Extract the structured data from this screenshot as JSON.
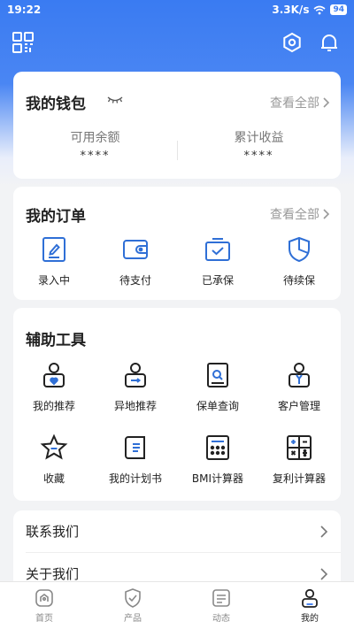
{
  "status_bar": {
    "time": "19:22",
    "network_speed": "3.3K/s",
    "battery": "94"
  },
  "wallet": {
    "title": "我的钱包",
    "view_all": "查看全部",
    "balance_label": "可用余额",
    "balance_value": "****",
    "earnings_label": "累计收益",
    "earnings_value": "****"
  },
  "orders": {
    "title": "我的订单",
    "view_all": "查看全部",
    "items": [
      {
        "label": "录入中",
        "icon": "edit-document-icon"
      },
      {
        "label": "待支付",
        "icon": "wallet-icon"
      },
      {
        "label": "已承保",
        "icon": "inbox-check-icon"
      },
      {
        "label": "待续保",
        "icon": "shield-icon"
      }
    ]
  },
  "tools": {
    "title": "辅助工具",
    "items": [
      {
        "label": "我的推荐",
        "icon": "user-heart-icon"
      },
      {
        "label": "异地推荐",
        "icon": "user-arrow-icon"
      },
      {
        "label": "保单查询",
        "icon": "document-search-icon"
      },
      {
        "label": "客户管理",
        "icon": "user-tie-icon"
      },
      {
        "label": "收藏",
        "icon": "star-icon"
      },
      {
        "label": "我的计划书",
        "icon": "book-icon"
      },
      {
        "label": "BMI计算器",
        "icon": "calculator-icon"
      },
      {
        "label": "复利计算器",
        "icon": "math-calculator-icon"
      }
    ]
  },
  "links": [
    {
      "label": "联系我们"
    },
    {
      "label": "关于我们"
    }
  ],
  "tabbar": [
    {
      "label": "首页",
      "icon": "home-icon"
    },
    {
      "label": "产品",
      "icon": "shield-check-icon"
    },
    {
      "label": "动态",
      "icon": "news-icon"
    },
    {
      "label": "我的",
      "icon": "user-icon",
      "active": true
    }
  ],
  "colors": {
    "primary": "#3a7bf2",
    "icon_blue": "#2f6fd6"
  }
}
